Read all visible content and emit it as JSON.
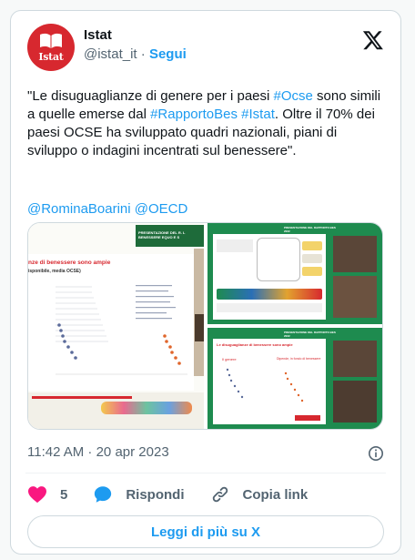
{
  "author": {
    "name": "Istat",
    "handle": "@istat_it",
    "separator": "·",
    "follow_label": "Segui",
    "avatar_text": "Istat"
  },
  "tweet": {
    "text_parts": [
      {
        "text": "\"Le disuguaglianze di genere per i paesi ",
        "type": "plain"
      },
      {
        "text": "#Ocse",
        "type": "link"
      },
      {
        "text": " sono simili a quelle emerse dal ",
        "type": "plain"
      },
      {
        "text": "#RapportoBes",
        "type": "link"
      },
      {
        "text": " ",
        "type": "plain"
      },
      {
        "text": "#Istat",
        "type": "link"
      },
      {
        "text": ". Oltre il 70% dei paesi OCSE ha sviluppato quadri nazionali, piani di sviluppo o indagini incentrati sul benessere\".",
        "type": "plain"
      }
    ],
    "mentions": [
      "@RominaBoarini",
      "@OECD"
    ]
  },
  "media": {
    "slide1": {
      "header": "PRESENTAZIONE DEL R. L BENESSERE EQUO E S",
      "title": "nze di benessere sono ampie",
      "subtitle": "isponibile, media OCSE)"
    },
    "slide2": {
      "header": "PRESENTAZIONE DEL RAPPORTO BES 2022"
    },
    "slide3": {
      "header": "PRESENTAZIONE DEL RAPPORTO BES 2022",
      "title": "Le disuguaglianze di benessere sono ampie",
      "label_a": "Il genere",
      "label_b": "Dipende, in fondo di benessere"
    }
  },
  "meta": {
    "timestamp": "11:42 AM · 20 apr 2023"
  },
  "actions": {
    "likes": "5",
    "reply_label": "Rispondi",
    "copy_label": "Copia link"
  },
  "read_more_label": "Leggi di più su X",
  "colors": {
    "accent": "#1d9bf0",
    "like": "#f91880",
    "brand_red": "#d7282f"
  },
  "icons": [
    "x-logo-icon",
    "info-icon",
    "heart-icon",
    "reply-icon",
    "link-icon"
  ]
}
